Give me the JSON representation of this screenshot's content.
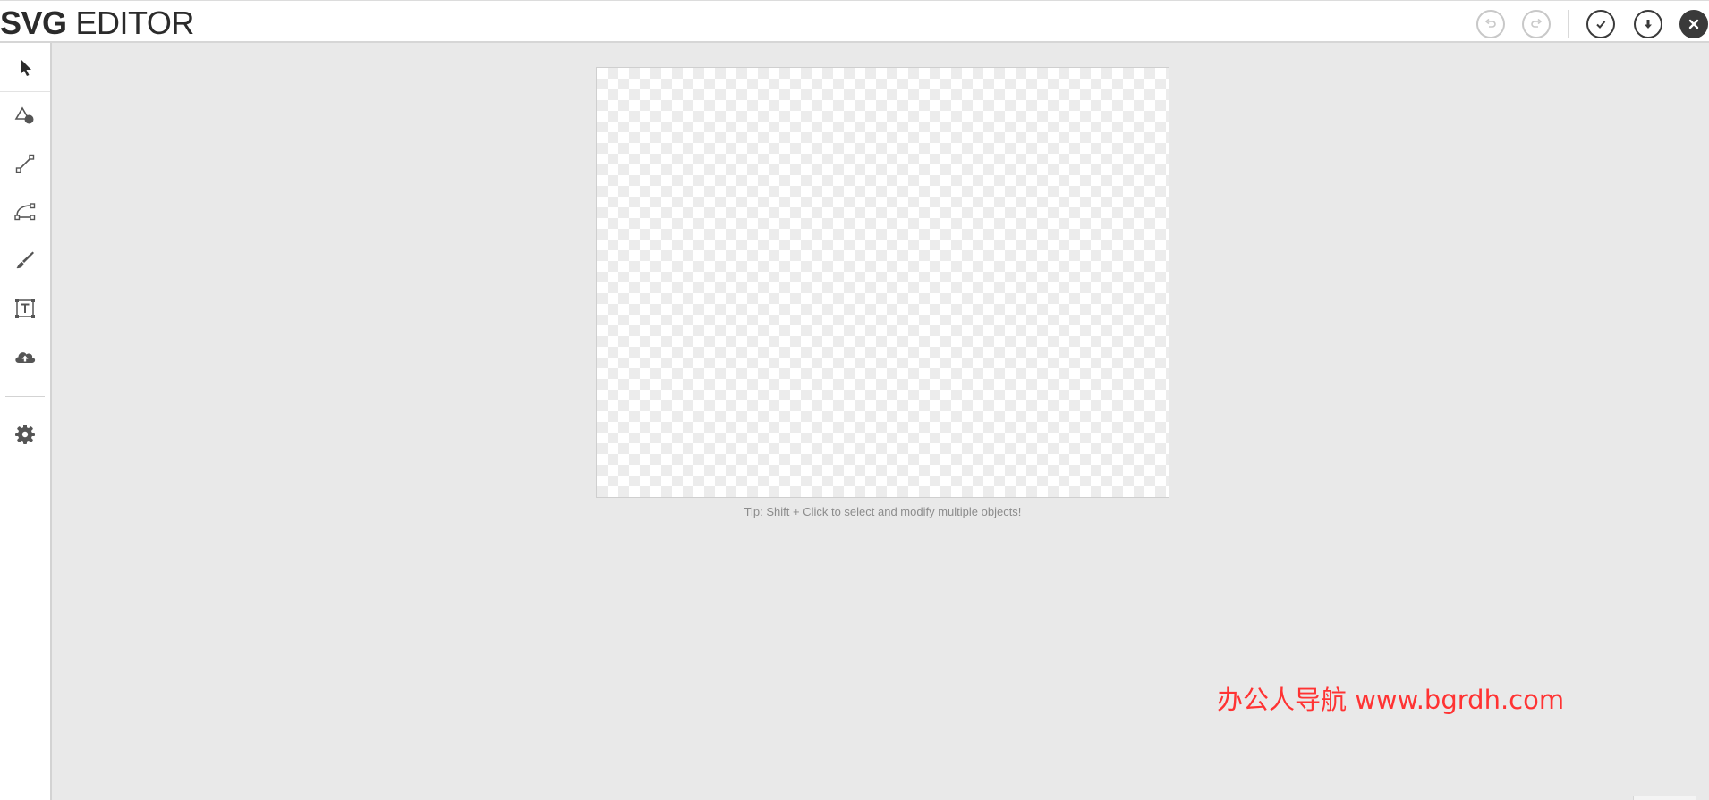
{
  "app": {
    "title_bold": "SVG",
    "title_light": "EDITOR"
  },
  "toolbar": {
    "buttons": [
      {
        "name": "undo",
        "icon": "undo-icon",
        "state": "disabled"
      },
      {
        "name": "redo",
        "icon": "redo-icon",
        "state": "disabled"
      },
      {
        "name": "confirm",
        "icon": "check-icon",
        "state": "enabled"
      },
      {
        "name": "download",
        "icon": "download-icon",
        "state": "enabled"
      },
      {
        "name": "close",
        "icon": "close-icon",
        "state": "enabled"
      }
    ]
  },
  "sidebar": {
    "tools": [
      {
        "name": "select",
        "icon": "pointer-icon",
        "active": true
      },
      {
        "name": "shapes",
        "icon": "shapes-icon",
        "active": false
      },
      {
        "name": "line",
        "icon": "line-icon",
        "active": false
      },
      {
        "name": "path",
        "icon": "path-icon",
        "active": false
      },
      {
        "name": "brush",
        "icon": "brush-icon",
        "active": false
      },
      {
        "name": "text",
        "icon": "text-icon",
        "active": false
      },
      {
        "name": "upload",
        "icon": "upload-cloud-icon",
        "active": false
      }
    ],
    "settings": {
      "name": "settings",
      "icon": "gear-icon"
    }
  },
  "canvas": {
    "tip": "Tip: Shift + Click to select and modify multiple objects!"
  },
  "watermark": {
    "text": "办公人导航  www.bgrdh.com"
  },
  "colors": {
    "background": "#e9e9e9",
    "toolbar": "#ffffff",
    "icon": "#3a3a3a",
    "disabled_icon": "#c8c8c8",
    "watermark": "#ff3333"
  }
}
